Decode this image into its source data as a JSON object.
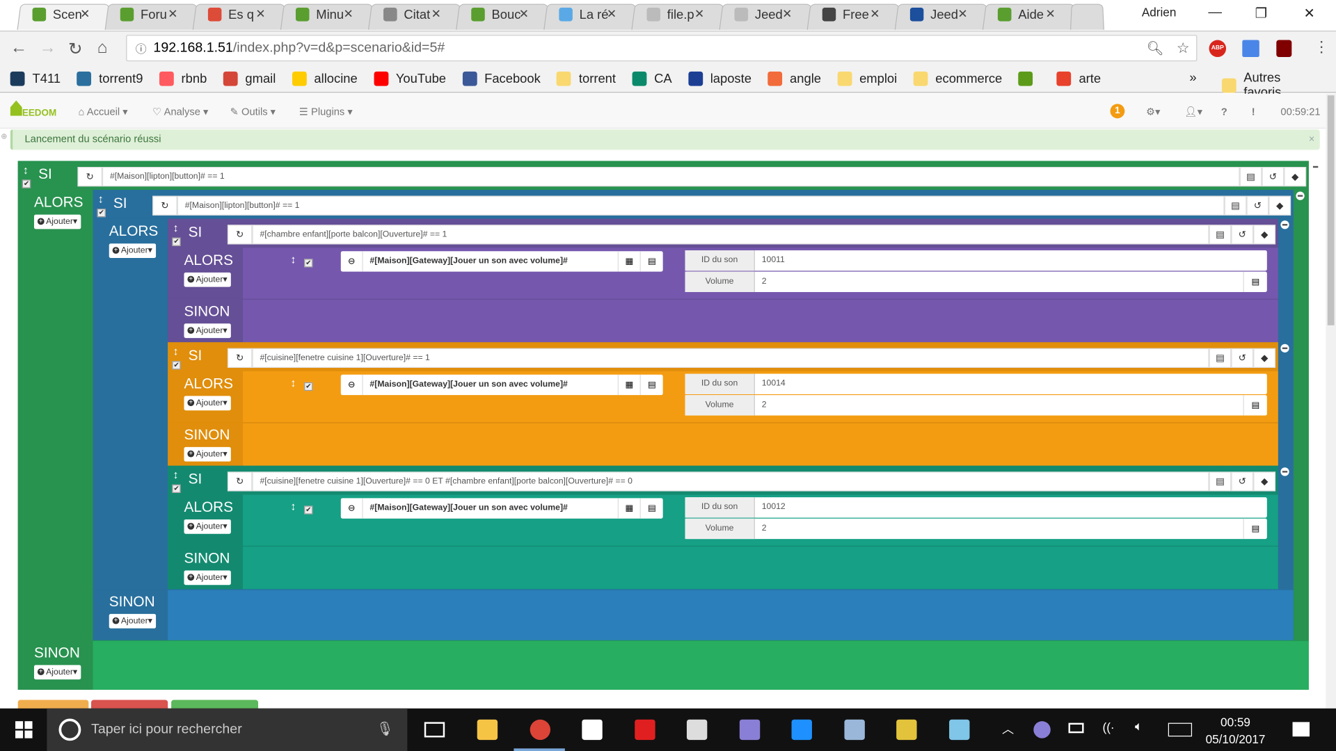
{
  "browser": {
    "tabs": [
      {
        "title": "Scen",
        "active": true,
        "icon": "jeedom-icon",
        "color": "#5a9e2f"
      },
      {
        "title": "Foru",
        "icon": "jeedom-icon",
        "color": "#5a9e2f"
      },
      {
        "title": "Es q",
        "icon": "google-plus-icon",
        "color": "#dd4b39"
      },
      {
        "title": "Minu",
        "icon": "jeedom-icon",
        "color": "#5a9e2f"
      },
      {
        "title": "Citat",
        "icon": "c-icon",
        "color": "#888888"
      },
      {
        "title": "Bouc",
        "icon": "jeedom-icon",
        "color": "#5a9e2f"
      },
      {
        "title": "La ré",
        "icon": "63-icon",
        "color": "#5aa9e6"
      },
      {
        "title": "file.p",
        "icon": "file-icon",
        "color": "#bbbbbb"
      },
      {
        "title": "Jeed",
        "icon": "file-icon",
        "color": "#bbbbbb"
      },
      {
        "title": "Free",
        "icon": "freebox-icon",
        "color": "#444444"
      },
      {
        "title": "Jeed",
        "icon": "api-domotik-icon",
        "color": "#1c4f9c"
      },
      {
        "title": "Aide",
        "icon": "jeedom-icon",
        "color": "#5a9e2f"
      }
    ],
    "user": "Adrien",
    "url_host": "192.168.1.51",
    "url_path": "/index.php?v=d&p=scenario&id=5#",
    "bookmarks": [
      {
        "label": "T411",
        "color": "#1a3b5c"
      },
      {
        "label": "torrent9",
        "color": "#2a6f9e"
      },
      {
        "label": "rbnb",
        "color": "#ff5a5f"
      },
      {
        "label": "gmail",
        "color": "#d44638"
      },
      {
        "label": "allocine",
        "color": "#fecc00"
      },
      {
        "label": "YouTube",
        "color": "#ff0000"
      },
      {
        "label": "Facebook",
        "color": "#3b5998"
      },
      {
        "label": "torrent",
        "color": "#f9d870"
      },
      {
        "label": "CA",
        "color": "#0a8a6a"
      },
      {
        "label": "laposte",
        "color": "#1c3f94"
      },
      {
        "label": "angle",
        "color": "#f26b3a"
      },
      {
        "label": "emploi",
        "color": "#f9d870"
      },
      {
        "label": "ecommerce",
        "color": "#f9d870"
      },
      {
        "label": "",
        "color": "#5c9b1a"
      },
      {
        "label": "arte",
        "color": "#e8412c"
      }
    ],
    "more": "»",
    "other_bookmarks": "Autres favoris"
  },
  "jeedom": {
    "logo": "EEDOM",
    "menu": [
      {
        "label": "Accueil",
        "icon": "home-icon"
      },
      {
        "label": "Analyse",
        "icon": "stethoscope-icon"
      },
      {
        "label": "Outils",
        "icon": "wrench-icon"
      },
      {
        "label": "Plugins",
        "icon": "list-icon"
      }
    ],
    "badge": "1",
    "time": "00:59:21",
    "alert": "Lancement du scénario réussi",
    "alert_close": "×"
  },
  "scenario": {
    "si": "SI",
    "alors": "ALORS",
    "sinon": "SINON",
    "add": "Ajouter",
    "root": {
      "condition": "#[Maison][lipton][button]# == 1",
      "colors": {
        "head": "#28924f",
        "body": "#27ae60"
      },
      "alors": [
        {
          "condition": "#[Maison][lipton][button]# == 1",
          "colors": {
            "head": "#286f9d",
            "body": "#2b7fba"
          },
          "alors": [
            {
              "condition": "#[chambre enfant][porte balcon][Ouverture]# == 1",
              "colors": {
                "head": "#654f96",
                "body": "#7558ae"
              },
              "action": {
                "cmd": "#[Maison][Gateway][Jouer un son avec volume]#",
                "params": [
                  {
                    "label": "ID du son",
                    "value": "10011"
                  },
                  {
                    "label": "Volume",
                    "value": "2"
                  }
                ]
              }
            },
            {
              "condition": "#[cuisine][fenetre cuisine 1][Ouverture]# == 1",
              "colors": {
                "head": "#e08e0b",
                "body": "#f39c12"
              },
              "action": {
                "cmd": "#[Maison][Gateway][Jouer un son avec volume]#",
                "params": [
                  {
                    "label": "ID du son",
                    "value": "10014"
                  },
                  {
                    "label": "Volume",
                    "value": "2"
                  }
                ]
              }
            },
            {
              "condition": "#[cuisine][fenetre cuisine 1][Ouverture]# == 0 ET #[chambre enfant][porte balcon][Ouverture]# == 0",
              "colors": {
                "head": "#138a70",
                "body": "#16a085"
              },
              "action": {
                "cmd": "#[Maison][Gateway][Jouer un son avec volume]#",
                "params": [
                  {
                    "label": "ID du son",
                    "value": "10012"
                  },
                  {
                    "label": "Volume",
                    "value": "2"
                  }
                ]
              }
            }
          ]
        }
      ]
    }
  },
  "bottom_buttons": [
    {
      "color": "#f0ad4e"
    },
    {
      "color": "#d9534f"
    },
    {
      "color": "#5cb85c"
    }
  ],
  "taskbar": {
    "search_placeholder": "Taper ici pour rechercher",
    "time": "00:59",
    "date": "05/10/2017",
    "apps": [
      {
        "name": "explorer-icon",
        "color": "#f6c445"
      },
      {
        "name": "chrome-icon",
        "color": "#db4437"
      },
      {
        "name": "store-icon",
        "color": "#ffffff"
      },
      {
        "name": "app-red-icon",
        "color": "#e02020"
      },
      {
        "name": "mail-icon",
        "color": "#dddddd"
      },
      {
        "name": "torrent-icon",
        "color": "#8a7fd6"
      },
      {
        "name": "edge-icon",
        "color": "#1e90ff"
      },
      {
        "name": "paint-icon",
        "color": "#9ab7d9"
      },
      {
        "name": "game-icon",
        "color": "#e3c33c"
      },
      {
        "name": "notepad-icon",
        "color": "#7fc6e8"
      }
    ]
  }
}
